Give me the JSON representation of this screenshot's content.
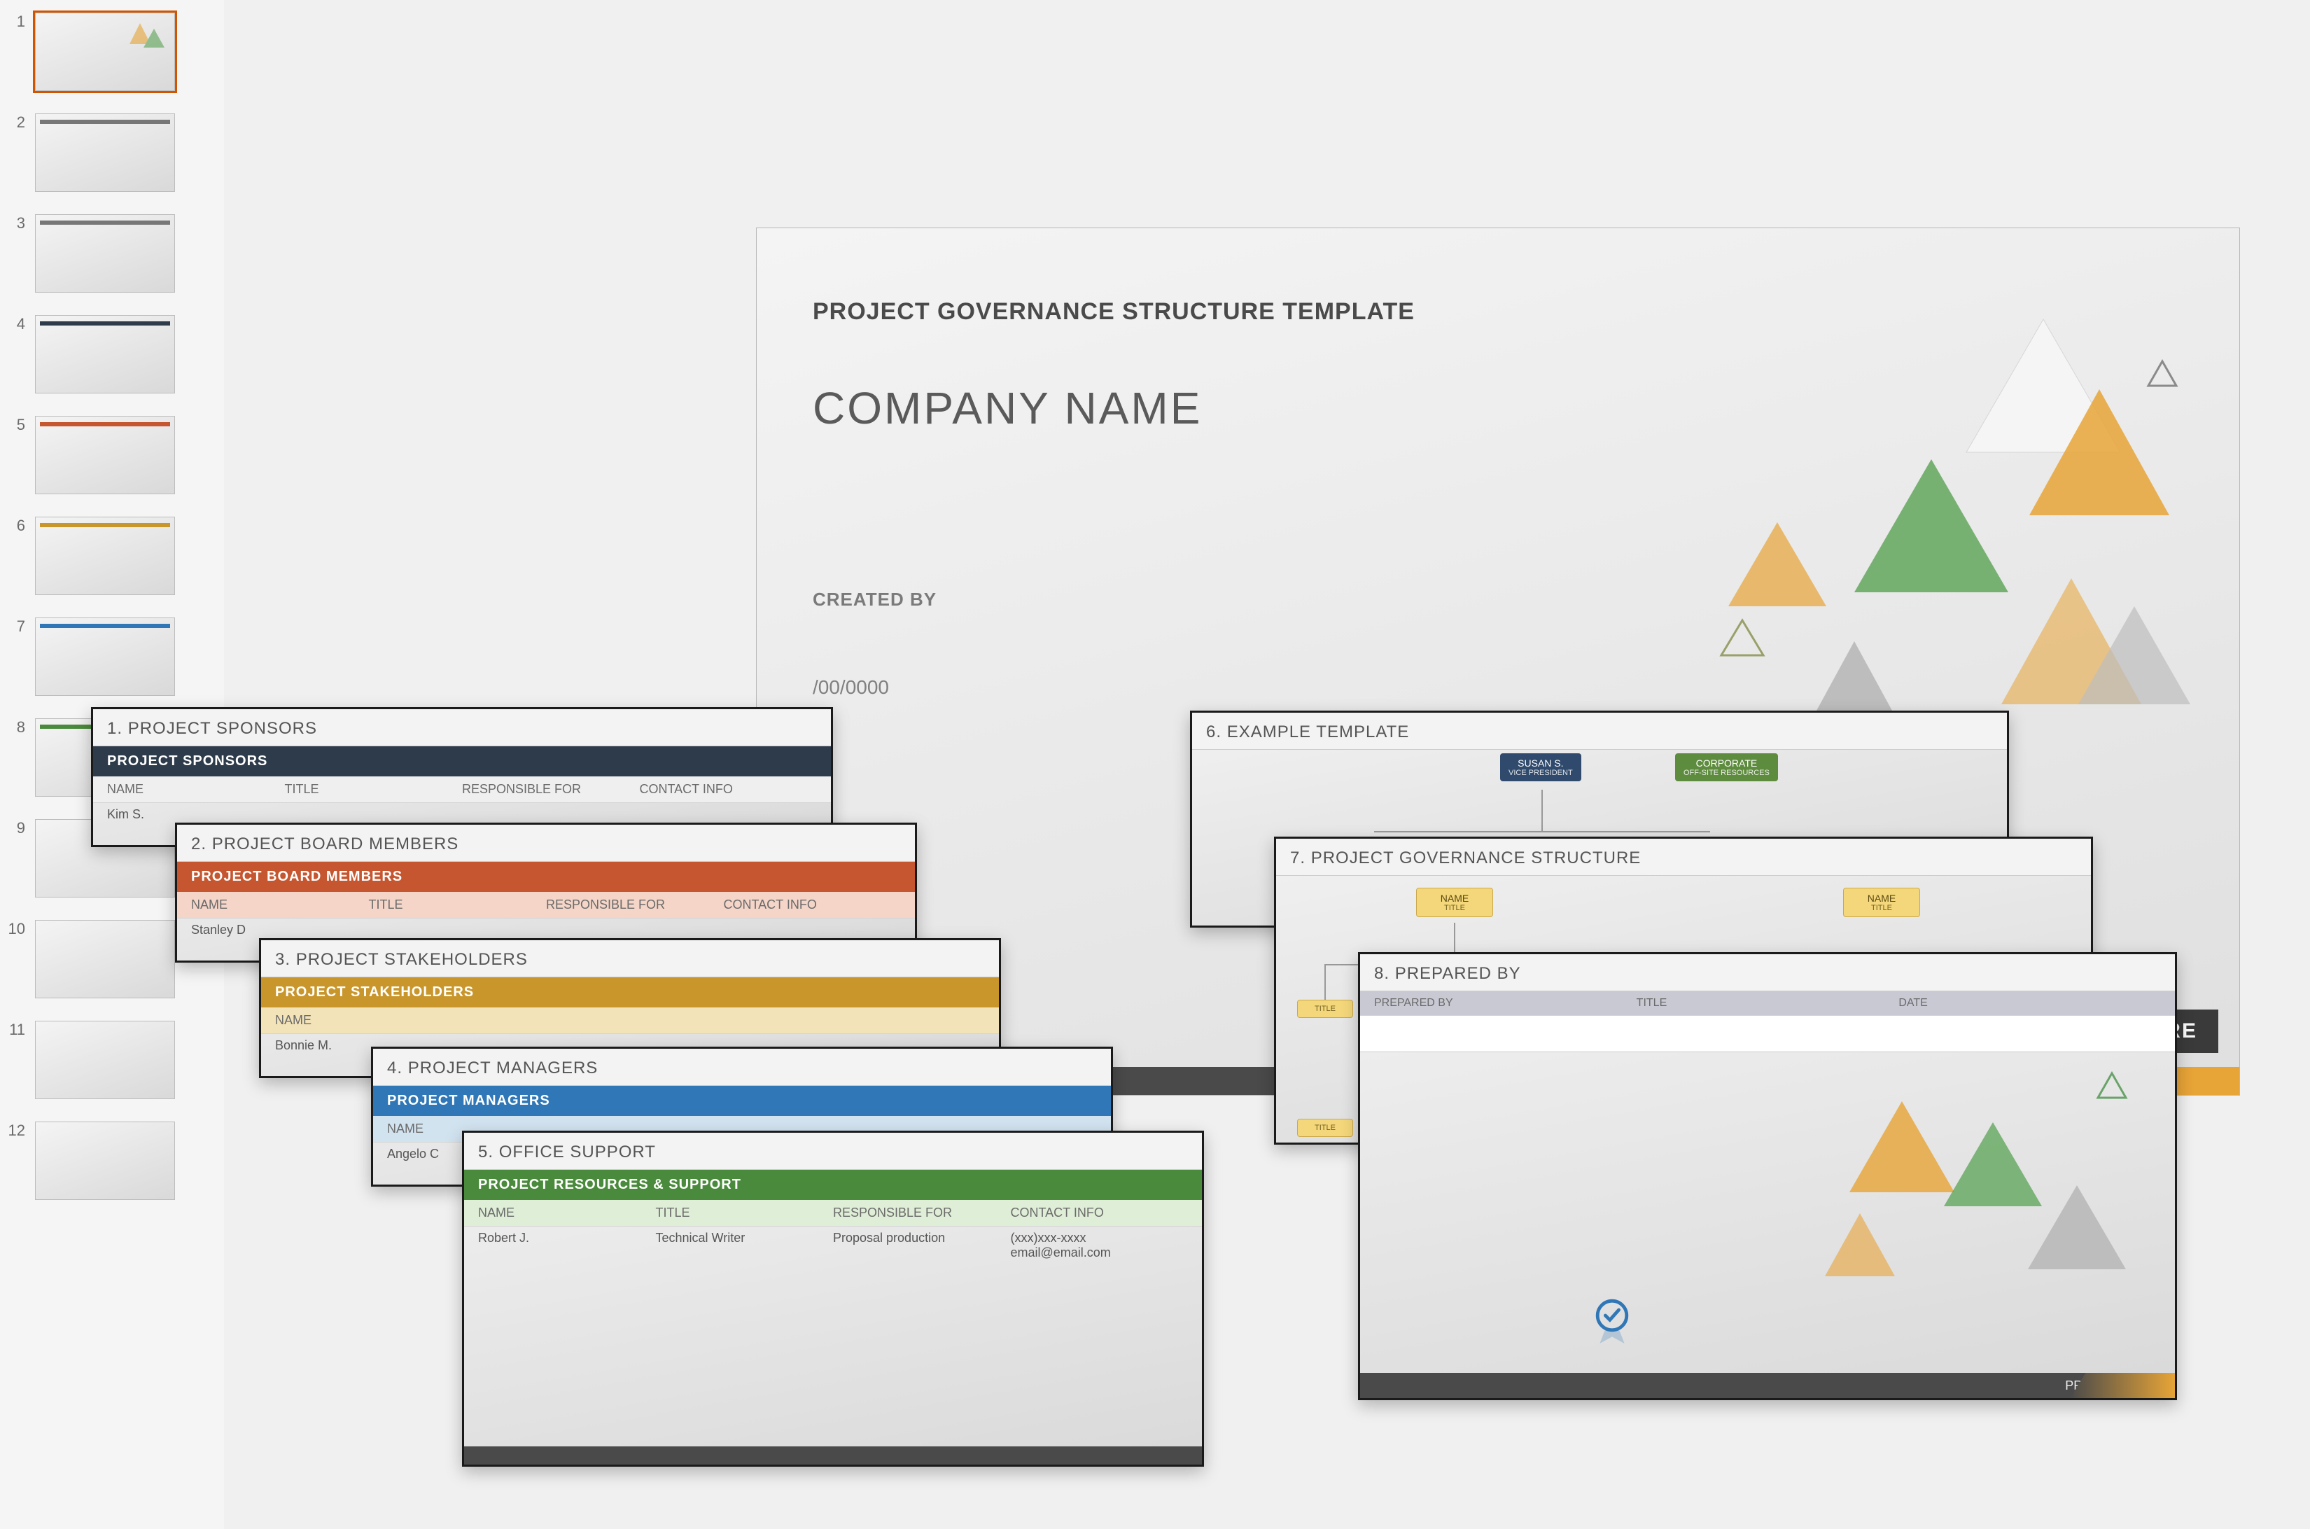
{
  "thumbs": [
    "1",
    "2",
    "3",
    "4",
    "5",
    "6",
    "7",
    "8",
    "9",
    "10",
    "11",
    "12"
  ],
  "main": {
    "title_small": "PROJECT GOVERNANCE STRUCTURE TEMPLATE",
    "company": "COMPANY NAME",
    "created_by": "CREATED BY",
    "date": "/00/0000",
    "structure_tag": "CTURE",
    "footer": ""
  },
  "cards": {
    "c1": {
      "num": "1.",
      "title": "PROJECT SPONSORS",
      "band": "PROJECT SPONSORS",
      "band_color": "#2d3b4b",
      "cols": [
        "NAME",
        "TITLE",
        "RESPONSIBLE FOR",
        "CONTACT INFO"
      ],
      "row": [
        "Kim S.",
        "",
        "",
        ""
      ]
    },
    "c2": {
      "num": "2.",
      "title": "PROJECT BOARD MEMBERS",
      "band": "PROJECT BOARD MEMBERS",
      "band_color": "#c5562f",
      "cols": [
        "NAME",
        "TITLE",
        "RESPONSIBLE FOR",
        "CONTACT INFO"
      ],
      "row": [
        "Stanley D",
        "",
        "",
        ""
      ]
    },
    "c3": {
      "num": "3.",
      "title": "PROJECT STAKEHOLDERS",
      "band": "PROJECT STAKEHOLDERS",
      "band_color": "#c9962c",
      "cols": [
        "NAME",
        "",
        "",
        ""
      ],
      "row": [
        "Bonnie M.",
        "",
        "",
        ""
      ]
    },
    "c4": {
      "num": "4.",
      "title": "PROJECT MANAGERS",
      "band": "PROJECT MANAGERS",
      "band_color": "#2f77b6",
      "cols": [
        "NAME",
        "",
        "",
        ""
      ],
      "row": [
        "Angelo C",
        "",
        "",
        ""
      ]
    },
    "c5": {
      "num": "5.",
      "title": "OFFICE SUPPORT",
      "band": "PROJECT RESOURCES & SUPPORT",
      "band_color": "#4a8a3c",
      "cols": [
        "NAME",
        "TITLE",
        "RESPONSIBLE FOR",
        "CONTACT INFO"
      ],
      "row": [
        "Robert J.",
        "Technical Writer",
        "Proposal production",
        "(xxx)xxx-xxxx\nemail@email.com"
      ]
    },
    "c6": {
      "num": "6.",
      "title": "EXAMPLE TEMPLATE",
      "node1": {
        "l1": "SUSAN S.",
        "l2": "VICE PRESIDENT"
      },
      "node2": {
        "l1": "CORPORATE",
        "l2": "OFF-SITE RESOURCES"
      }
    },
    "c7": {
      "num": "7.",
      "title": "PROJECT GOVERNANCE STRUCTURE",
      "node": {
        "l1": "NAME",
        "l2": "TITLE"
      }
    },
    "c8": {
      "num": "8.",
      "title": "PREPARED BY",
      "cols": [
        "PREPARED BY",
        "TITLE",
        "DATE"
      ],
      "footer": "PREPARED BY"
    }
  }
}
